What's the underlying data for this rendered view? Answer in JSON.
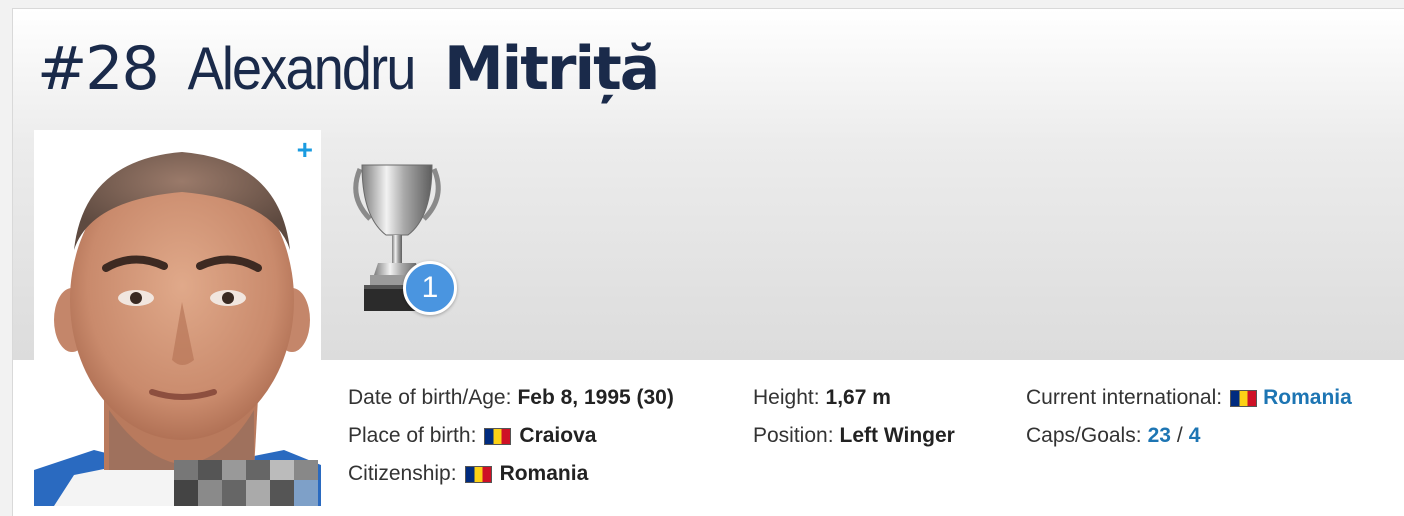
{
  "player": {
    "number": "#28",
    "first_name": "Alexandru",
    "last_name": "Mitriță"
  },
  "photo": {
    "expand_label": "+"
  },
  "trophy": {
    "count": "1",
    "icon": "trophy-cup-icon"
  },
  "details": {
    "dob_label": "Date of birth/Age:",
    "dob_value": "Feb 8, 1995 (30)",
    "pob_label": "Place of birth:",
    "pob_value": "Craiova",
    "citizenship_label": "Citizenship:",
    "citizenship_value": "Romania",
    "height_label": "Height:",
    "height_value": "1,67 m",
    "position_label": "Position:",
    "position_value": "Left Winger",
    "intl_label": "Current international:",
    "intl_value": "Romania",
    "caps_label": "Caps/Goals:",
    "caps_value": "23",
    "caps_sep": "/",
    "goals_value": "4"
  },
  "flag": {
    "country": "Romania",
    "colors": [
      "#002b7f",
      "#fcd116",
      "#ce1126"
    ]
  },
  "colors": {
    "title": "#1a2a4a",
    "link": "#1d75b3",
    "badge": "#4a95e0",
    "plus": "#1a9be0"
  }
}
